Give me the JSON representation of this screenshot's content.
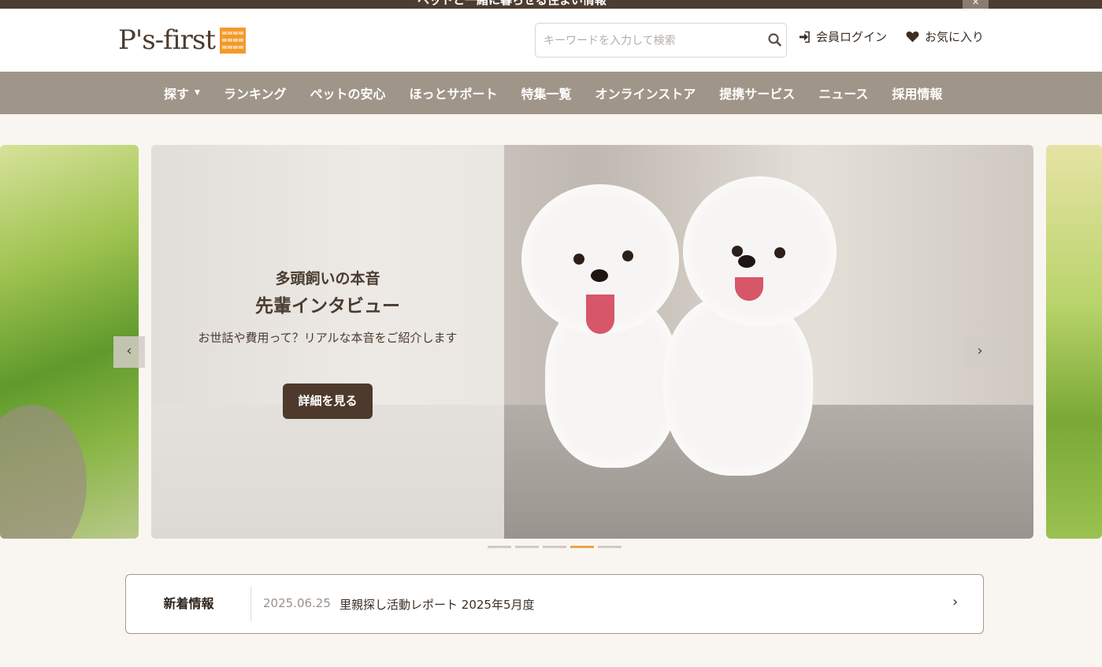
{
  "topbar": {
    "text": "ペットと一緒に暮らせる住まい情報",
    "close_label": "×"
  },
  "header": {
    "logo_text": "P's-first",
    "search_placeholder": "キーワードを入力して検索",
    "search_icon": "search-icon",
    "login_label": "会員ログイン",
    "login_icon": "sign-in-icon",
    "favorites_label": "お気に入り",
    "favorites_icon": "heart-icon"
  },
  "nav": {
    "items": [
      {
        "label": "探す",
        "has_dropdown": true
      },
      {
        "label": "ランキング"
      },
      {
        "label": "ペットの安心"
      },
      {
        "label": "ほっとサポート"
      },
      {
        "label": "特集一覧"
      },
      {
        "label": "オンラインストア"
      },
      {
        "label": "提携サービス"
      },
      {
        "label": "ニュース"
      },
      {
        "label": "採用情報"
      }
    ],
    "caret": "▼"
  },
  "hero": {
    "subtitle": "多頭飼いの本音",
    "title": "先輩インタビュー",
    "description": "お世話や費用って？リアルな本音をご紹介します",
    "button_label": "詳細を見る",
    "prev_label": "‹",
    "next_label": "›",
    "dots_count": 5,
    "active_dot": 3
  },
  "news": {
    "label": "新着情報",
    "date": "2025.06.25",
    "title": "里親探し活動レポート 2025年5月度",
    "arrow": "›"
  },
  "colors": {
    "brand_brown": "#4d3c30",
    "nav_bg": "#a09589",
    "accent_orange": "#f39a2b",
    "page_bg": "#f9f6f1"
  }
}
